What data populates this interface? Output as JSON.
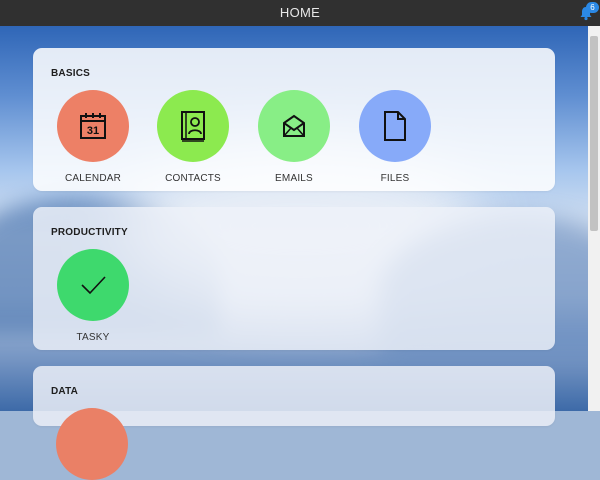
{
  "header": {
    "title": "HOME",
    "notification_count": "6"
  },
  "sections": [
    {
      "title": "BASICS",
      "apps": [
        {
          "label": "CALENDAR",
          "icon": "calendar-icon",
          "icon_text": "31",
          "color": "#ed8066"
        },
        {
          "label": "CONTACTS",
          "icon": "contacts-icon",
          "color": "#8cea4f"
        },
        {
          "label": "EMAILS",
          "icon": "email-icon",
          "color": "#88ee86"
        },
        {
          "label": "FILES",
          "icon": "file-icon",
          "color": "#87aaf9"
        }
      ]
    },
    {
      "title": "PRODUCTIVITY",
      "apps": [
        {
          "label": "TASKY",
          "icon": "checkmark-icon",
          "color": "#3ed96d"
        }
      ]
    },
    {
      "title": "DATA",
      "apps": [
        {
          "color": "#ea8066"
        }
      ]
    }
  ]
}
